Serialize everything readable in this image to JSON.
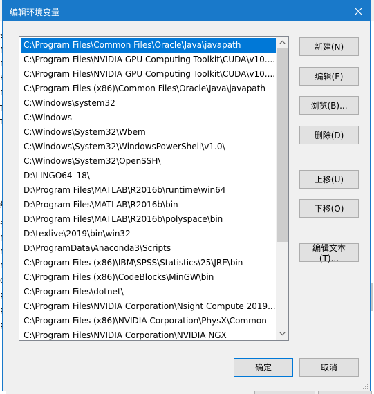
{
  "window": {
    "title": "编辑环境变量"
  },
  "background": {
    "left_chars": [
      "安",
      "M",
      "Pa",
      "Py",
      "Py",
      "TE",
      "TM",
      "统",
      "安",
      "N",
      "N",
      "N",
      "O",
      "Pa",
      "PA",
      "PF"
    ]
  },
  "list": {
    "items": [
      "C:\\Program Files\\Common Files\\Oracle\\Java\\javapath",
      "C:\\Program Files\\NVIDIA GPU Computing Toolkit\\CUDA\\v10....",
      "C:\\Program Files\\NVIDIA GPU Computing Toolkit\\CUDA\\v10....",
      "C:\\Program Files (x86)\\Common Files\\Oracle\\Java\\javapath",
      "C:\\Windows\\system32",
      "C:\\Windows",
      "C:\\Windows\\System32\\Wbem",
      "C:\\Windows\\System32\\WindowsPowerShell\\v1.0\\",
      "C:\\Windows\\System32\\OpenSSH\\",
      "D:\\LINGO64_18\\",
      "D:\\Program Files\\MATLAB\\R2016b\\runtime\\win64",
      "D:\\Program Files\\MATLAB\\R2016b\\bin",
      "D:\\Program Files\\MATLAB\\R2016b\\polyspace\\bin",
      "D:\\texlive\\2019\\bin\\win32",
      "D:\\ProgramData\\Anaconda3\\Scripts",
      "C:\\Program Files (x86)\\IBM\\SPSS\\Statistics\\25\\JRE\\bin",
      "C:\\Program Files (x86)\\CodeBlocks\\MinGW\\bin",
      "C:\\Program Files\\dotnet\\",
      "C:\\Program Files\\NVIDIA Corporation\\Nsight Compute 2019....",
      "C:\\Program Files (x86)\\NVIDIA Corporation\\PhysX\\Common",
      "C:\\Program Files\\NVIDIA Corporation\\NVIDIA NGX"
    ],
    "selected_index": 0
  },
  "buttons": {
    "new": "新建(N)",
    "edit": "编辑(E)",
    "browse": "浏览(B)...",
    "delete": "删除(D)",
    "move_up": "上移(U)",
    "move_down": "下移(O)",
    "edit_text": "编辑文本(T)...",
    "ok": "确定",
    "cancel": "取消"
  },
  "colors": {
    "title_bar": "#1979ca",
    "selection": "#0078d7"
  }
}
